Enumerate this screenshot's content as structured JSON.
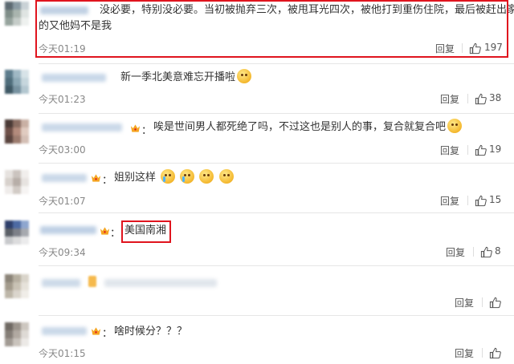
{
  "comments": [
    {
      "text": "没必要，特别没必要。当初被抛弃三次，被甩耳光四次，被他打到重伤住院，最后被赶出家门",
      "text2": "的又他妈不是我",
      "time": "今天01:19",
      "reply": "回复",
      "likes": "197"
    },
    {
      "text": "新一季北美意难忘开播啦",
      "time": "今天01:23",
      "reply": "回复",
      "likes": "38"
    },
    {
      "text": "唉是世间男人都死绝了吗，不过这也是别人的事，复合就复合吧",
      "time": "今天03:00",
      "reply": "回复",
      "likes": "19"
    },
    {
      "text": "姐别这样",
      "time": "今天01:07",
      "reply": "回复",
      "likes": "15"
    },
    {
      "text": "美国南湘",
      "time": "今天09:34",
      "reply": "回复",
      "likes": "8"
    },
    {
      "reply": "回复"
    },
    {
      "text": "啥时候分？？？",
      "time": "今天01:15",
      "reply": "回复"
    }
  ],
  "colon": "：",
  "colors": {
    "highlight": "#e0141e",
    "vip": "#f5a623"
  },
  "icons": {
    "like": "thumbs-up-icon",
    "vip": "crown-icon"
  }
}
